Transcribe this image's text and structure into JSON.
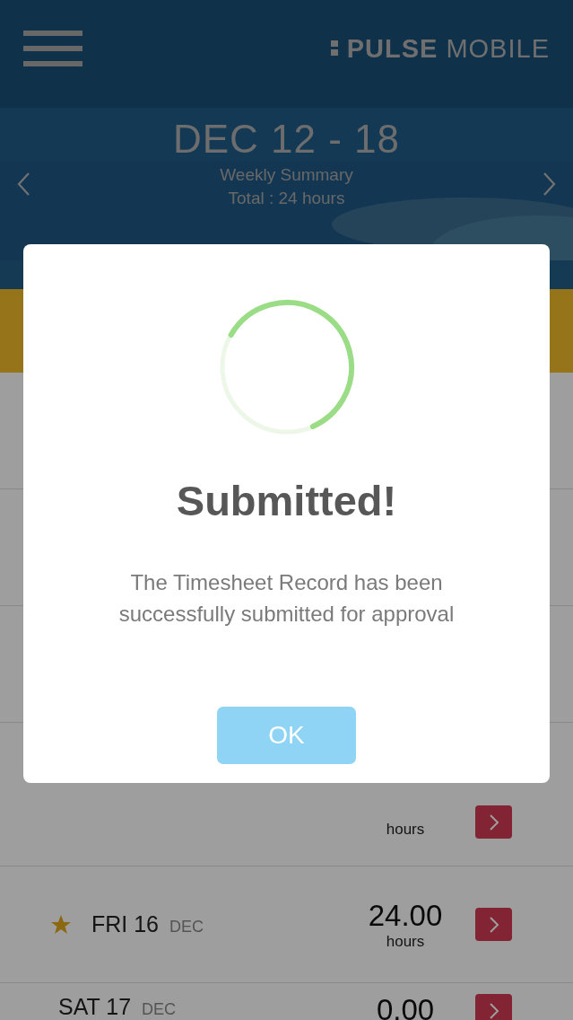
{
  "header": {
    "brand_bold": "PULSE",
    "brand_light": "MOBILE",
    "week": "DEC 12 - 18",
    "subtitle": "Weekly Summary",
    "total": "Total : 24 hours"
  },
  "days": [
    {
      "kind": "hidden"
    },
    {
      "kind": "hidden"
    },
    {
      "kind": "hidden"
    },
    {
      "kind": "partial",
      "unit": "hours"
    },
    {
      "kind": "full",
      "starred": true,
      "day": "FRI 16",
      "month": "DEC",
      "hours": "24.00",
      "unit": "hours"
    },
    {
      "kind": "full",
      "starred": false,
      "day": "SAT 17",
      "month": "DEC",
      "hours": "0.00"
    }
  ],
  "dialog": {
    "level": 0.6,
    "title": "Submitted!",
    "message": "The Timesheet Record has been successfully submitted for approval",
    "button": "OK"
  }
}
